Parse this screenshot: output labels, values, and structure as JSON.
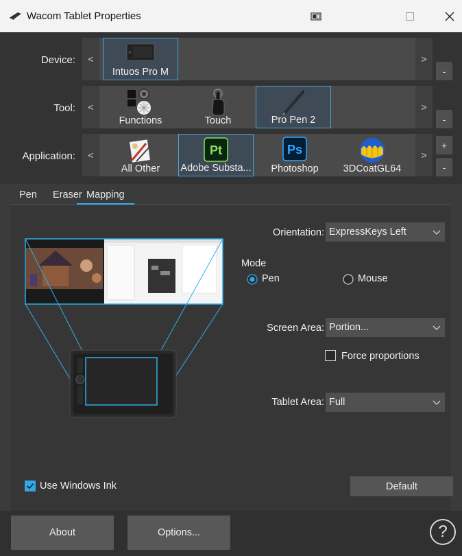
{
  "window": {
    "title": "Wacom Tablet Properties"
  },
  "device": {
    "label": "Device:",
    "prev": "<",
    "next": ">",
    "items": [
      {
        "label": "Intuos Pro M",
        "icon": "tablet-icon",
        "selected": true
      }
    ],
    "side_buttons": [
      "-"
    ]
  },
  "tool": {
    "label": "Tool:",
    "prev": "<",
    "next": ">",
    "items": [
      {
        "label": "Functions",
        "icon": "functions-icon",
        "selected": false
      },
      {
        "label": "Touch",
        "icon": "touch-hand-icon",
        "selected": false
      },
      {
        "label": "Pro Pen 2",
        "icon": "pen-icon",
        "selected": true
      }
    ],
    "side_buttons": [
      "-"
    ]
  },
  "application": {
    "label": "Application:",
    "prev": "<",
    "next": ">",
    "items": [
      {
        "label": "All Other",
        "icon": "all-other-apps-icon",
        "selected": false
      },
      {
        "label": "Adobe Substa...",
        "icon": "substance-painter-icon",
        "icon_text": "Pt",
        "selected": true
      },
      {
        "label": "Photoshop",
        "icon": "photoshop-icon",
        "icon_text": "Ps",
        "selected": false
      },
      {
        "label": "3DCoatGL64",
        "icon": "3dcoat-icon",
        "selected": false
      }
    ],
    "side_buttons": [
      "+",
      "-"
    ]
  },
  "tabs": [
    {
      "label": "Pen",
      "active": false
    },
    {
      "label": "Eraser",
      "active": false
    },
    {
      "label": "Mapping",
      "active": true
    }
  ],
  "mapping": {
    "orientation_label": "Orientation:",
    "orientation_value": "ExpressKeys Left",
    "mode_label": "Mode",
    "mode_pen": "Pen",
    "mode_mouse": "Mouse",
    "mode_selected": "Pen",
    "screen_area_label": "Screen Area:",
    "screen_area_value": "Portion...",
    "force_proportions": "Force proportions",
    "force_proportions_checked": false,
    "tablet_area_label": "Tablet Area:",
    "tablet_area_value": "Full",
    "use_windows_ink": "Use Windows Ink",
    "use_windows_ink_checked": true,
    "default_button": "Default"
  },
  "footer": {
    "about": "About",
    "options": "Options...",
    "help_icon": "?"
  },
  "colors": {
    "accent": "#31a8e4",
    "selected_tile": "#3e4a56",
    "background": "#3b3b3b"
  }
}
